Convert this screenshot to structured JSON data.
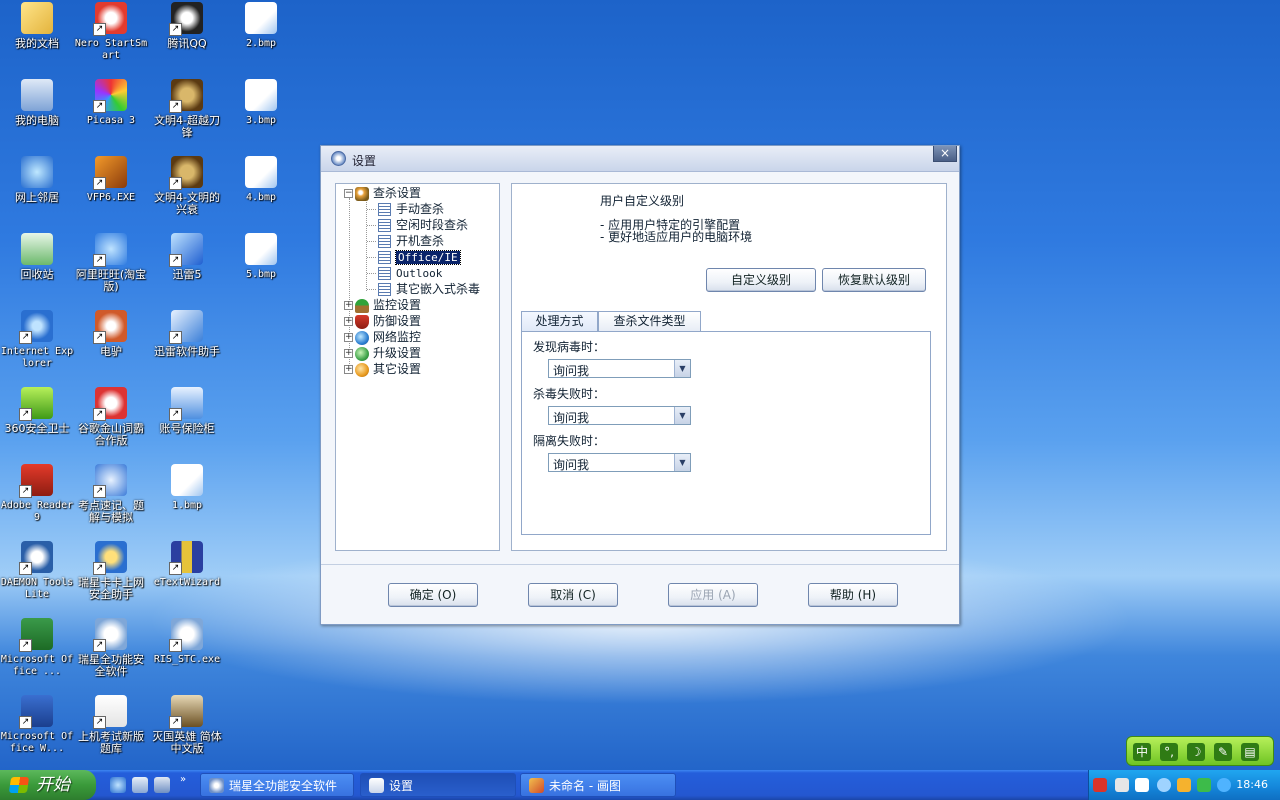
{
  "desktop": {
    "icons": [
      {
        "label": "我的文档",
        "icon": "documents-folder-icon"
      },
      {
        "label": "Nero StartSmart",
        "icon": "nero-icon"
      },
      {
        "label": "腾讯QQ",
        "icon": "qq-penguin-icon"
      },
      {
        "label": "2.bmp",
        "icon": "bitmap-file-icon"
      },
      {
        "label": "我的电脑",
        "icon": "my-computer-icon"
      },
      {
        "label": "Picasa 3",
        "icon": "picasa-icon"
      },
      {
        "label": "文明4-超越刀锋",
        "icon": "civ4-icon"
      },
      {
        "label": "3.bmp",
        "icon": "bitmap-file-icon"
      },
      {
        "label": "网上邻居",
        "icon": "network-places-icon"
      },
      {
        "label": "VFP6.EXE",
        "icon": "foxpro-icon"
      },
      {
        "label": "文明4-文明的兴衰",
        "icon": "civ4-icon"
      },
      {
        "label": "4.bmp",
        "icon": "bitmap-file-icon"
      },
      {
        "label": "回收站",
        "icon": "recycle-bin-icon"
      },
      {
        "label": "阿里旺旺(淘宝版)",
        "icon": "aliwangwang-icon"
      },
      {
        "label": "迅雷5",
        "icon": "thunder-icon"
      },
      {
        "label": "5.bmp",
        "icon": "bitmap-file-icon"
      },
      {
        "label": "Internet Explorer",
        "icon": "internet-explorer-icon"
      },
      {
        "label": "电驴",
        "icon": "emule-icon"
      },
      {
        "label": "迅雷软件助手",
        "icon": "thunder-assistant-icon"
      },
      {
        "label": "360安全卫士",
        "icon": "360-security-icon"
      },
      {
        "label": "谷歌金山词霸合作版",
        "icon": "dictionary-icon"
      },
      {
        "label": "账号保险柜",
        "icon": "account-safe-icon"
      },
      {
        "label": "Adobe Reader 9",
        "icon": "adobe-reader-icon"
      },
      {
        "label": "考点速记、题解与模拟",
        "icon": "exam-icon"
      },
      {
        "label": "1.bmp",
        "icon": "bitmap-file-icon"
      },
      {
        "label": "DAEMON Tools Lite",
        "icon": "daemon-tools-icon"
      },
      {
        "label": "瑞星卡卡上网安全助手",
        "icon": "rising-kaka-icon"
      },
      {
        "label": "eTextWizard",
        "icon": "books-icon"
      },
      {
        "label": "Microsoft Office ...",
        "icon": "excel-icon"
      },
      {
        "label": "瑞星全功能安全软件",
        "icon": "rising-lion-icon"
      },
      {
        "label": "RIS_STC.exe",
        "icon": "rising-lion-icon"
      },
      {
        "label": "Microsoft Office W...",
        "icon": "word-icon"
      },
      {
        "label": "上机考试新版题库",
        "icon": "ncre-icon"
      },
      {
        "label": "灭国英雄 简体中文版",
        "icon": "game-icon"
      }
    ]
  },
  "dialog": {
    "title": "设置",
    "close_label": "×",
    "tree": {
      "root": "查杀设置",
      "children": [
        "手动查杀",
        "空闲时段查杀",
        "开机查杀",
        "Office/IE",
        "Outlook",
        "其它嵌入式杀毒"
      ],
      "groups": [
        "监控设置",
        "防御设置",
        "网络监控",
        "升级设置",
        "其它设置"
      ]
    },
    "panel": {
      "title": "用户自定义级别",
      "lines": [
        "- 应用用户特定的引擎配置",
        "- 更好地适应用户的电脑环境"
      ],
      "custom_level_button": "自定义级别",
      "restore_default_button": "恢复默认级别",
      "tabs": [
        "处理方式",
        "查杀文件类型"
      ],
      "fields": [
        {
          "label": "发现病毒时：",
          "value": "询问我"
        },
        {
          "label": "杀毒失败时：",
          "value": "询问我"
        },
        {
          "label": "隔离失败时：",
          "value": "询问我"
        }
      ]
    },
    "buttons": {
      "ok": "确定 (O)",
      "cancel": "取消 (C)",
      "apply": "应用 (A)",
      "help": "帮助 (H)"
    }
  },
  "ime": {
    "keys": [
      "中",
      "°,",
      "☽",
      "✎",
      "▤"
    ]
  },
  "taskbar": {
    "start_label": "开始",
    "tasks": [
      {
        "label": "瑞星全功能安全软件"
      },
      {
        "label": "设置"
      },
      {
        "label": "未命名 - 画图"
      }
    ],
    "clock": "18:46"
  }
}
